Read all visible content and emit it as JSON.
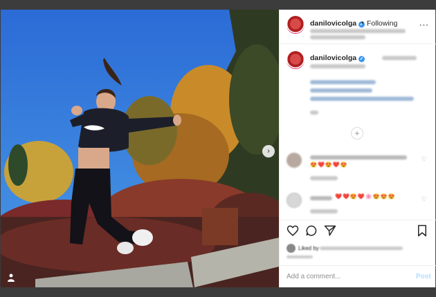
{
  "post": {
    "username": "danilovicolga",
    "follow_separator": "•",
    "follow_state": "Following",
    "more_label": "...",
    "next_arrow": "›",
    "caption_username": "danilovicolga",
    "load_more": "+",
    "add_comment_placeholder": "Add a comment...",
    "post_button": "Post",
    "likes_text": "Liked by",
    "colors": {
      "accent": "#3897f0",
      "sky": "#2d6fd4",
      "text": "#262626",
      "muted": "#8e8e8e"
    },
    "icons": [
      "heart-icon",
      "comment-icon",
      "share-icon",
      "bookmark-icon",
      "verified-icon",
      "user-tag-icon"
    ]
  }
}
